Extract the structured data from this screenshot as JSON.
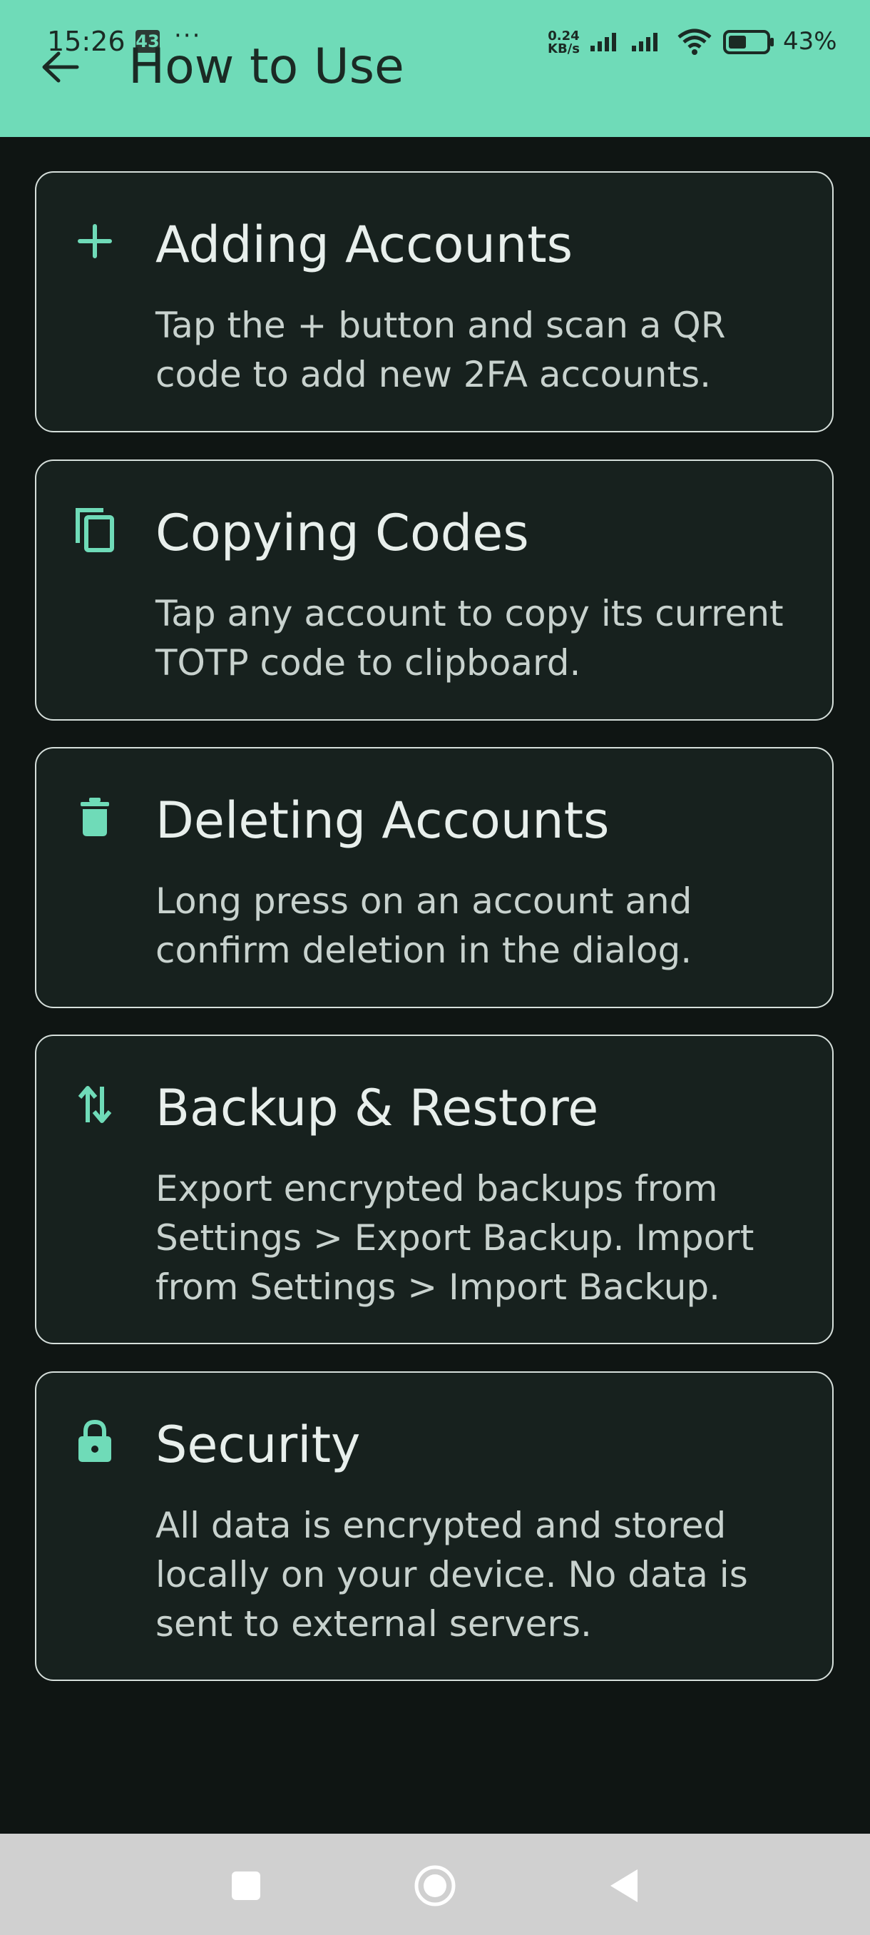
{
  "status_bar": {
    "time": "15:26",
    "notification_badge": "43",
    "more_dots": "···",
    "net_speed_value": "0.24",
    "net_speed_unit": "KB/s",
    "battery_percent": "43%"
  },
  "app_bar": {
    "title": "How to Use",
    "back_icon": "arrow-back-icon",
    "background": "#6fdbb8"
  },
  "cards": [
    {
      "icon": "plus-icon",
      "title": "Adding Accounts",
      "description": "Tap the + button and scan a QR code to add new 2FA accounts."
    },
    {
      "icon": "copy-icon",
      "title": "Copying Codes",
      "description": "Tap any account to copy its current TOTP code to clipboard."
    },
    {
      "icon": "trash-icon",
      "title": "Deleting Accounts",
      "description": "Long press on an account and confirm deletion in the dialog."
    },
    {
      "icon": "swap-vertical-icon",
      "title": "Backup & Restore",
      "description": "Export encrypted backups from Settings > Export Backup. Import from Settings > Import Backup."
    },
    {
      "icon": "lock-icon",
      "title": "Security",
      "description": "All data is encrypted and stored locally on your device. No data is sent to external servers."
    }
  ],
  "colors": {
    "accent": "#6fdbb8",
    "background": "#0f1513",
    "card": "#17211e",
    "card_border": "#d6dfdb"
  },
  "nav_bar": {
    "recents_icon": "square-icon",
    "home_icon": "circle-icon",
    "back_icon": "triangle-back-icon"
  }
}
